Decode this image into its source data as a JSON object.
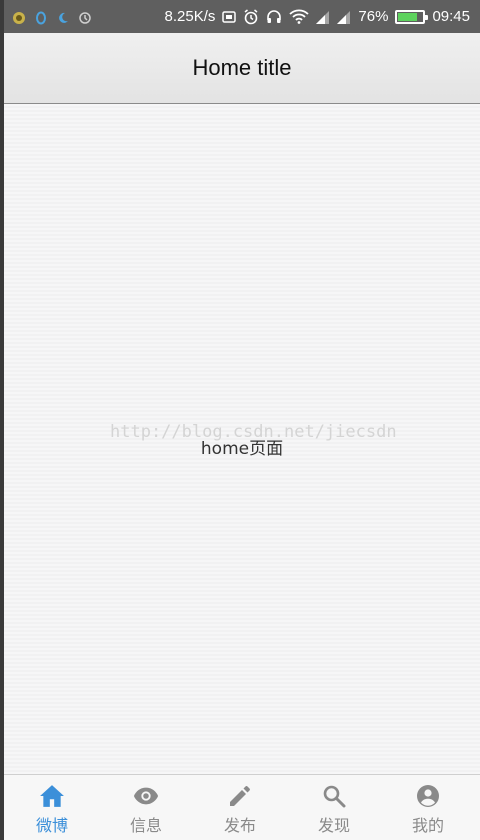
{
  "status_bar": {
    "network_speed": "8.25K/s",
    "battery_percent": "76%",
    "battery_level": 0.76,
    "time": "09:45"
  },
  "header": {
    "title": "Home title"
  },
  "content": {
    "watermark": "http://blog.csdn.net/jiecsdn",
    "center_text": "home页面"
  },
  "tabs": [
    {
      "label": "微博",
      "icon": "home-icon",
      "active": true
    },
    {
      "label": "信息",
      "icon": "eye-icon",
      "active": false
    },
    {
      "label": "发布",
      "icon": "pencil-icon",
      "active": false
    },
    {
      "label": "发现",
      "icon": "search-icon",
      "active": false
    },
    {
      "label": "我的",
      "icon": "account-circle-icon",
      "active": false
    }
  ],
  "colors": {
    "tab_active": "#3b8fd9",
    "tab_inactive": "#8a8a8a",
    "status_bar_bg": "#5f5f5f",
    "battery_fill": "#5fd35f"
  }
}
